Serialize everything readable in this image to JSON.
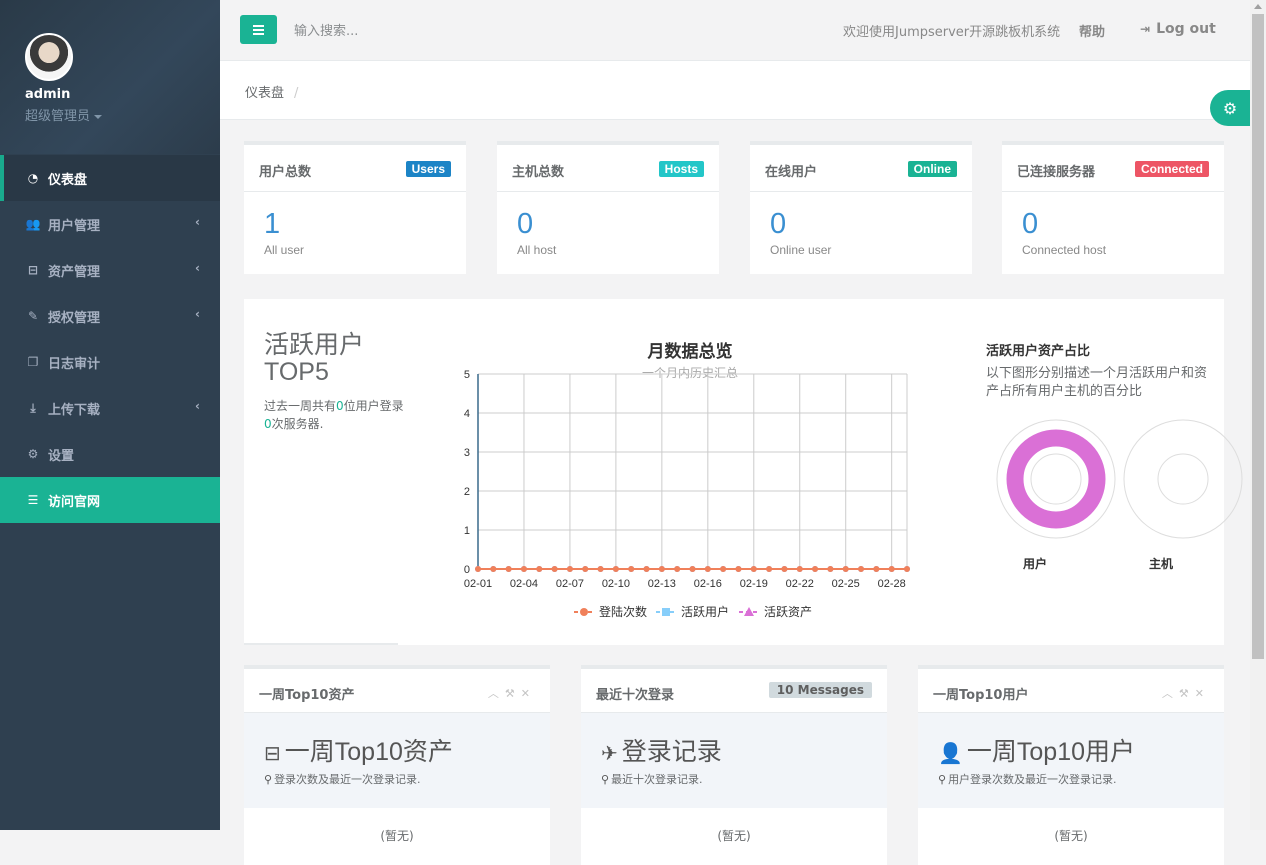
{
  "sidebar": {
    "username": "admin",
    "role": "超级管理员",
    "items": [
      {
        "label": "仪表盘",
        "icon": "dashboard-icon",
        "glyph": "◔",
        "arrow": ""
      },
      {
        "label": "用户管理",
        "icon": "users-icon",
        "glyph": "👥",
        "arrow": "‹"
      },
      {
        "label": "资产管理",
        "icon": "inbox-icon",
        "glyph": "⊟",
        "arrow": "‹"
      },
      {
        "label": "授权管理",
        "icon": "edit-icon",
        "glyph": "✎",
        "arrow": "‹"
      },
      {
        "label": "日志审计",
        "icon": "copy-icon",
        "glyph": "❐",
        "arrow": ""
      },
      {
        "label": "上传下载",
        "icon": "download-icon",
        "glyph": "⤓",
        "arrow": "‹"
      },
      {
        "label": "设置",
        "icon": "gears-icon",
        "glyph": "⚙",
        "arrow": ""
      },
      {
        "label": "访问官网",
        "icon": "database-icon",
        "glyph": "☰",
        "arrow": ""
      }
    ]
  },
  "topbar": {
    "search_placeholder": "输入搜索...",
    "welcome": "欢迎使用Jumpserver开源跳板机系统",
    "help": "帮助",
    "logout": "Log out"
  },
  "breadcrumb": {
    "current": "仪表盘",
    "separator": "/"
  },
  "stats": [
    {
      "title": "用户总数",
      "badge": "Users",
      "badge_color": "#1c84c6",
      "value": "1",
      "sub": "All user"
    },
    {
      "title": "主机总数",
      "badge": "Hosts",
      "badge_color": "#23c6c8",
      "value": "0",
      "sub": "All host"
    },
    {
      "title": "在线用户",
      "badge": "Online",
      "badge_color": "#1ab394",
      "value": "0",
      "sub": "Online user"
    },
    {
      "title": "已连接服务器",
      "badge": "Connected",
      "badge_color": "#ed5565",
      "value": "0",
      "sub": "Connected host"
    }
  ],
  "active_users": {
    "title_line1": "活跃用户",
    "title_line2": "TOP5",
    "desc_prefix": "过去一周共有",
    "user_count": "0",
    "desc_mid": "位用户登录",
    "login_count": "0",
    "desc_suffix": "次服务器."
  },
  "monthly": {
    "title": "月数据总览",
    "subtitle": "一个月内历史汇总"
  },
  "ratio": {
    "title": "活跃用户资产占比",
    "desc": "以下图形分别描述一个月活跃用户和资产占所有用户主机的百分比",
    "label_user": "用户",
    "label_host": "主机",
    "user_color": "#da70d6"
  },
  "chart_data": {
    "type": "line",
    "x": [
      "02-01",
      "02-02",
      "02-03",
      "02-04",
      "02-05",
      "02-06",
      "02-07",
      "02-08",
      "02-09",
      "02-10",
      "02-11",
      "02-12",
      "02-13",
      "02-14",
      "02-15",
      "02-16",
      "02-17",
      "02-18",
      "02-19",
      "02-20",
      "02-21",
      "02-22",
      "02-23",
      "02-24",
      "02-25",
      "02-26",
      "02-27",
      "02-28",
      "02-29"
    ],
    "x_tick_labels": [
      "02-01",
      "02-04",
      "02-07",
      "02-10",
      "02-13",
      "02-16",
      "02-19",
      "02-22",
      "02-25",
      "02-28"
    ],
    "y_ticks": [
      "0",
      "1",
      "2",
      "3",
      "4",
      "5"
    ],
    "ylim": [
      0,
      5
    ],
    "series": [
      {
        "name": "登陆次数",
        "color": "#f0805a",
        "values": [
          0,
          0,
          0,
          0,
          0,
          0,
          0,
          0,
          0,
          0,
          0,
          0,
          0,
          0,
          0,
          0,
          0,
          0,
          0,
          0,
          0,
          0,
          0,
          0,
          0,
          0,
          0,
          0,
          0
        ]
      },
      {
        "name": "活跃用户",
        "color": "#87cefa",
        "values": [
          0,
          0,
          0,
          0,
          0,
          0,
          0,
          0,
          0,
          0,
          0,
          0,
          0,
          0,
          0,
          0,
          0,
          0,
          0,
          0,
          0,
          0,
          0,
          0,
          0,
          0,
          0,
          0,
          0
        ]
      },
      {
        "name": "活跃资产",
        "color": "#da70d6",
        "values": [
          0,
          0,
          0,
          0,
          0,
          0,
          0,
          0,
          0,
          0,
          0,
          0,
          0,
          0,
          0,
          0,
          0,
          0,
          0,
          0,
          0,
          0,
          0,
          0,
          0,
          0,
          0,
          0,
          0
        ]
      }
    ],
    "legend": "bottom-center",
    "grid": true
  },
  "panels": [
    {
      "title": "一周Top10资产",
      "big": "一周Top10资产",
      "icon": "inbox-icon",
      "glyph": "⊟",
      "desc": "登录次数及最近一次登录记录.",
      "foot": "(暂无)"
    },
    {
      "title": "最近十次登录",
      "badge": "10 Messages",
      "big": "登录记录",
      "icon": "paper-plane-icon",
      "glyph": "✈",
      "desc": "最近十次登录记录.",
      "foot": "(暂无)"
    },
    {
      "title": "一周Top10用户",
      "big": "一周Top10用户",
      "icon": "user-icon",
      "glyph": "👤",
      "desc": "用户登录次数及最近一次登录记录.",
      "foot": "(暂无)"
    }
  ]
}
